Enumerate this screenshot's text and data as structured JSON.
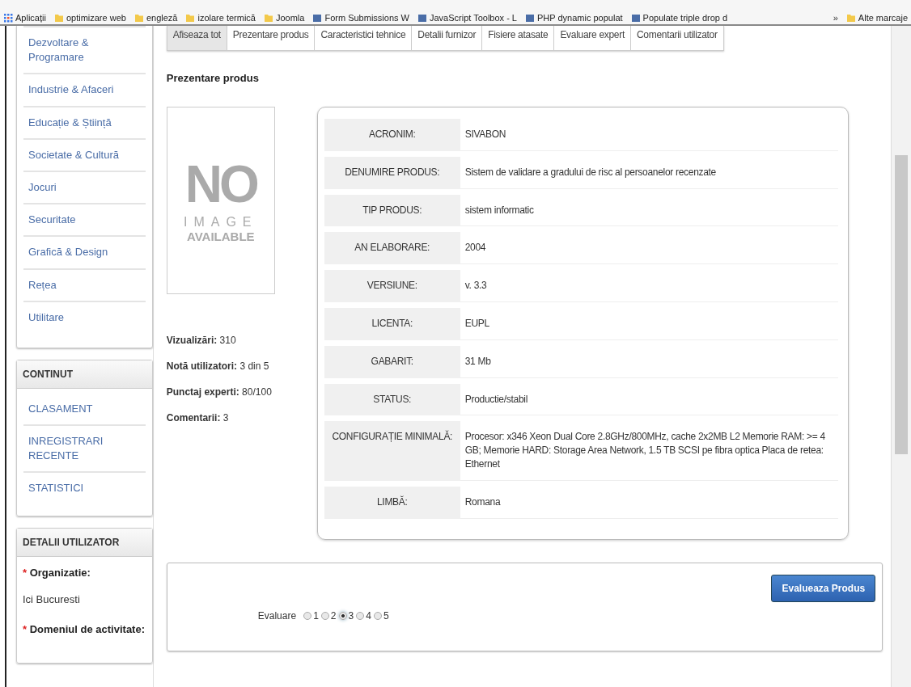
{
  "bookmarks": {
    "items": [
      {
        "label": "Aplicații",
        "kind": "apps"
      },
      {
        "label": "optimizare web",
        "kind": "folder"
      },
      {
        "label": "engleză",
        "kind": "folder"
      },
      {
        "label": "izolare termică",
        "kind": "folder"
      },
      {
        "label": "Joomla",
        "kind": "folder"
      },
      {
        "label": "Form Submissions W",
        "kind": "site"
      },
      {
        "label": "JavaScript Toolbox - L",
        "kind": "site"
      },
      {
        "label": "PHP dynamic populat",
        "kind": "site"
      },
      {
        "label": "Populate triple drop d",
        "kind": "site"
      }
    ],
    "overflow": "»",
    "other": "Alte marcaje"
  },
  "sidebar": {
    "categories": [
      "Dezvoltare & Programare",
      "Industrie & Afaceri",
      "Educație & Știință",
      "Societate & Cultură",
      "Jocuri",
      "Securitate",
      "Grafică & Design",
      "Rețea",
      "Utilitare"
    ],
    "content_panel": {
      "title": "CONTINUT",
      "links": [
        "CLASAMENT",
        "INREGISTRARI RECENTE",
        "STATISTICI"
      ]
    },
    "user_panel": {
      "title": "DETALII UTILIZATOR",
      "fields": [
        {
          "marker": "*",
          "label": "Organizatie:",
          "value": "Ici Bucuresti"
        },
        {
          "marker": "*",
          "label": "Domeniul de activitate:"
        }
      ]
    }
  },
  "tabs": [
    {
      "label": "Afiseaza tot",
      "selected": true
    },
    {
      "label": "Prezentare produs",
      "selected": false
    },
    {
      "label": "Caracteristici tehnice",
      "selected": false
    },
    {
      "label": "Detalii furnizor",
      "selected": false
    },
    {
      "label": "Fisiere atasate",
      "selected": false
    },
    {
      "label": "Evaluare expert",
      "selected": false
    },
    {
      "label": "Comentarii utilizator",
      "selected": false
    }
  ],
  "section_title": "Prezentare produs",
  "placeholder_image": {
    "big": "NO",
    "middle": "IMAGE",
    "bottom": "AVAILABLE"
  },
  "stats": [
    {
      "label": "Vizualizări:",
      "value": "310"
    },
    {
      "label": "Notă utilizatori:",
      "value": "3 din 5"
    },
    {
      "label": "Punctaj experti:",
      "value": "80/100"
    },
    {
      "label": "Comentarii:",
      "value": "3"
    }
  ],
  "details": [
    {
      "label": "ACRONIM:",
      "value": "SIVABON"
    },
    {
      "label": "DENUMIRE PRODUS:",
      "value": "Sistem de validare a gradului de risc al persoanelor recenzate"
    },
    {
      "label": "TIP PRODUS:",
      "value": "sistem informatic"
    },
    {
      "label": "AN ELABORARE:",
      "value": "2004"
    },
    {
      "label": "VERSIUNE:",
      "value": "v. 3.3"
    },
    {
      "label": "LICENTA:",
      "value": "EUPL"
    },
    {
      "label": "GABARIT:",
      "value": "31 Mb"
    },
    {
      "label": "STATUS:",
      "value": "Productie/stabil"
    },
    {
      "label": "CONFIGURAȚIE MINIMALĂ:",
      "value": "Procesor: x346 Xeon Dual Core 2.8GHz/800MHz, cache 2x2MB L2 Memorie RAM: >= 4 GB; Memorie HARD: Storage Area Network, 1.5 TB SCSI pe fibra optica Placa de retea: Ethernet"
    },
    {
      "label": "LIMBĂ:",
      "value": "Romana"
    }
  ],
  "rating": {
    "label": "Evaluare",
    "options": [
      {
        "label": "1",
        "selected": false
      },
      {
        "label": "2",
        "selected": false
      },
      {
        "label": "3",
        "selected": true
      },
      {
        "label": "4",
        "selected": false
      },
      {
        "label": "5",
        "selected": false
      }
    ],
    "button": "Evalueaza Produs"
  }
}
